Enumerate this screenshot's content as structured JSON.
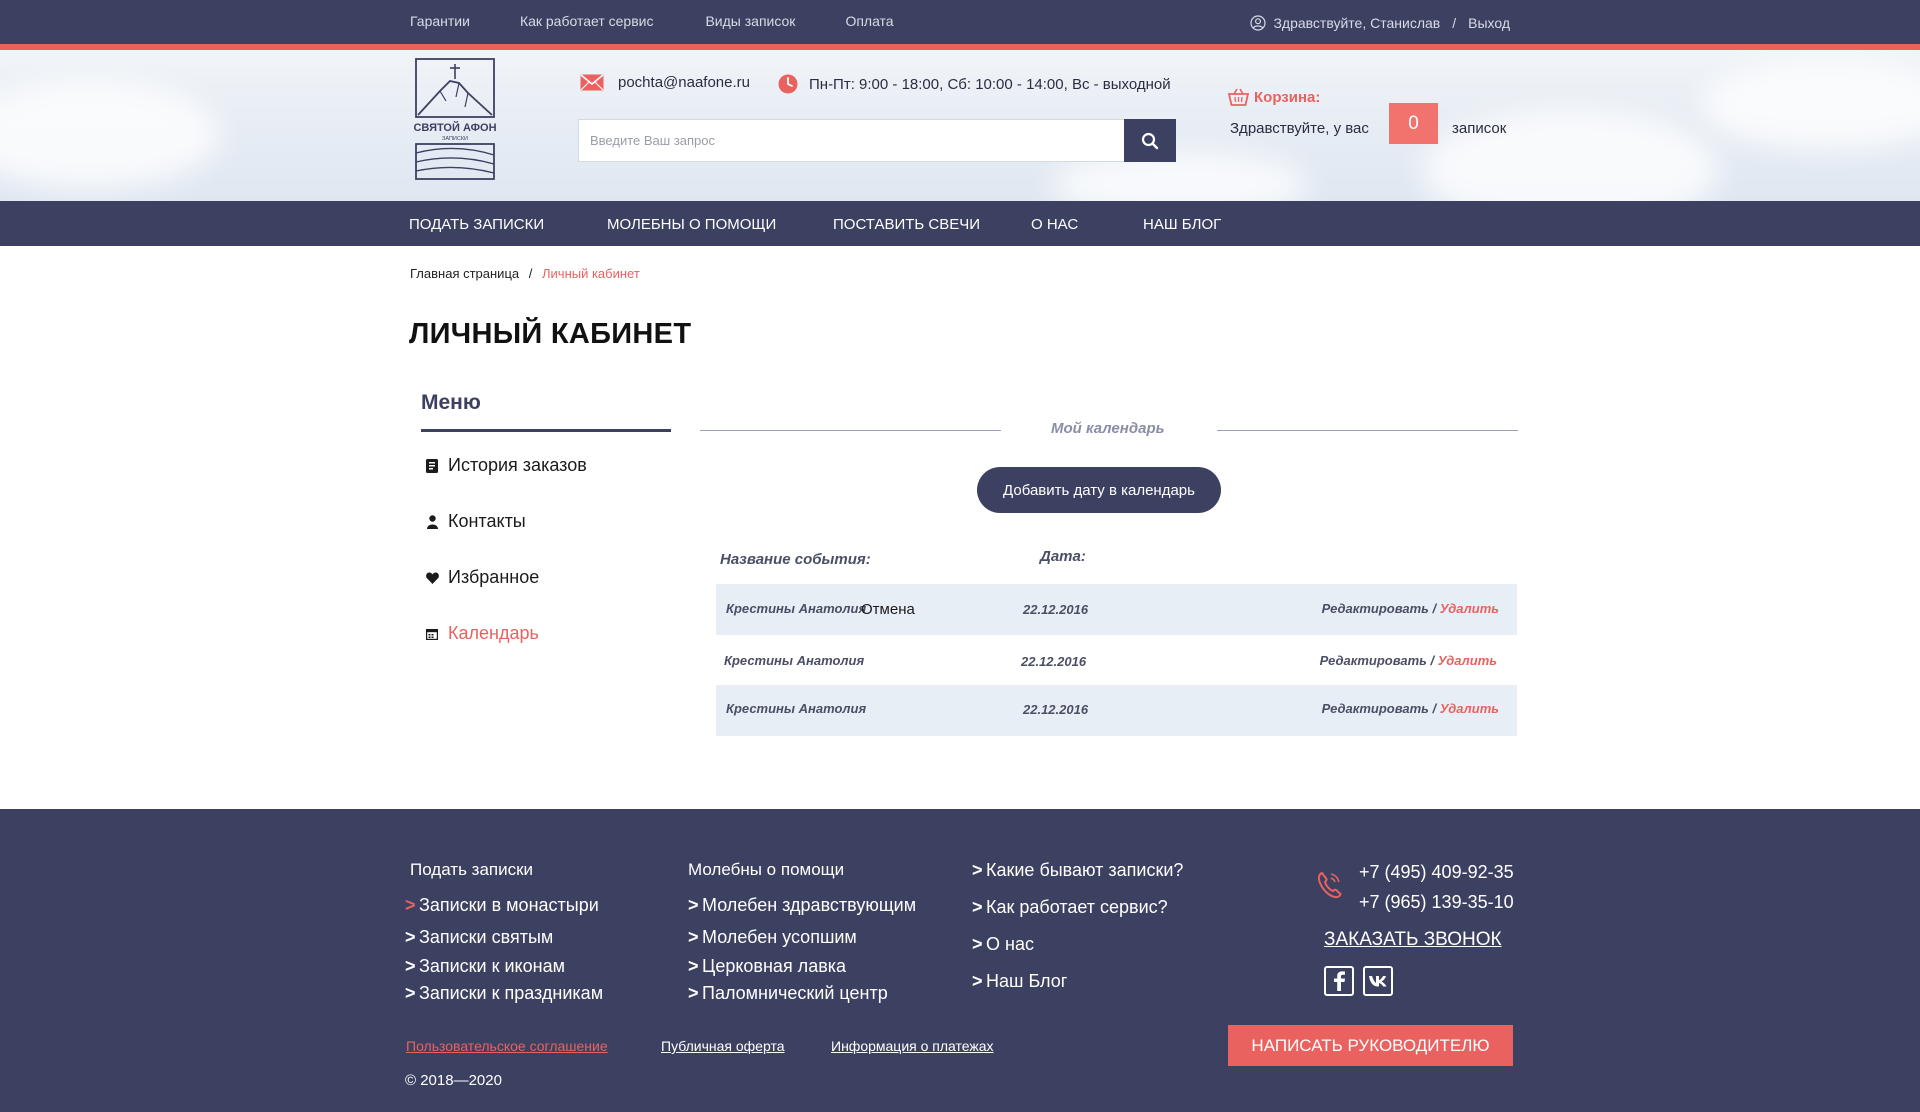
{
  "topbar": {
    "nav": [
      "Гарантии",
      "Как работает сервис",
      "Виды записок",
      "Оплата"
    ],
    "greeting": "Здравствуйте, Станислав",
    "separator": "/",
    "logout": "Выход"
  },
  "header": {
    "logo_text": "СВЯТОЙ АФОН",
    "logo_subtext": "ЗАПИСКИ",
    "email": "pochta@naafone.ru",
    "hours": "Пн-Пт: 9:00 - 18:00, Сб: 10:00 - 14:00, Вс - выходной",
    "search_placeholder": "Введите Ваш запрос",
    "cart": {
      "title": "Корзина:",
      "text_before": "Здравствуйте, у вас",
      "count": "0",
      "text_after": "записок"
    }
  },
  "mainnav": [
    "ПОДАТЬ ЗАПИСКИ",
    "МОЛЕБНЫ О ПОМОЩИ",
    "ПОСТАВИТЬ СВЕЧИ",
    "О НАС",
    "НАШ БЛОГ"
  ],
  "breadcrumb": {
    "home": "Главная страница",
    "separator": "/",
    "current": "Личный кабинет"
  },
  "page_title": "ЛИЧНЫЙ КАБИНЕТ",
  "sidebar": {
    "title": "Меню",
    "items": [
      {
        "label": "История заказов",
        "icon": "receipt-icon",
        "active": false
      },
      {
        "label": "Контакты",
        "icon": "user-icon",
        "active": false
      },
      {
        "label": "Избранное",
        "icon": "heart-icon",
        "active": true
      },
      {
        "label": "Календарь",
        "icon": "calendar-icon",
        "active": true
      }
    ]
  },
  "calendar": {
    "title": "Мой календарь",
    "add_button": "Добавить дату в календарь",
    "col_event": "Название события:",
    "col_date": "Дата:",
    "rows": [
      {
        "name": "Крестины Анатолия",
        "extra": "Отмена",
        "date": "22.12.2016",
        "edit": "Редактировать",
        "sep": "/",
        "delete": "Удалить"
      },
      {
        "name": "Крестины Анатолия",
        "extra": "",
        "date": "22.12.2016",
        "edit": "Редактировать",
        "sep": "/",
        "delete": "Удалить"
      },
      {
        "name": "Крестины Анатолия",
        "extra": "",
        "date": "22.12.2016",
        "edit": "Редактировать",
        "sep": "/",
        "delete": "Удалить"
      }
    ]
  },
  "footer": {
    "col1": {
      "heading": "Подать записки",
      "links": [
        "Записки в монастыри",
        "Записки святым",
        "Записки к иконам",
        "Записки к праздникам"
      ]
    },
    "col2": {
      "heading": "Молебны о помощи",
      "links": [
        "Молебен здравствующим",
        "Молебен усопшим",
        "Церковная лавка",
        "Паломнический центр"
      ]
    },
    "col3": {
      "links": [
        "Какие бывают записки?",
        "Как работает сервис?",
        "О нас",
        "Наш Блог"
      ]
    },
    "phones": [
      "+7 (495) 409-92-35",
      "+7 (965) 139-35-10"
    ],
    "order_call": "ЗАКАЗАТЬ ЗВОНОК",
    "legal": [
      "Пользовательское соглашение",
      "Публичная оферта",
      "Информация о платежах"
    ],
    "copyright": "© 2018—2020",
    "write_button": "НАПИСАТЬ РУКОВОДИТЕЛЮ",
    "colors": {
      "accent": "#e9625f",
      "navy": "#3d4161"
    }
  }
}
